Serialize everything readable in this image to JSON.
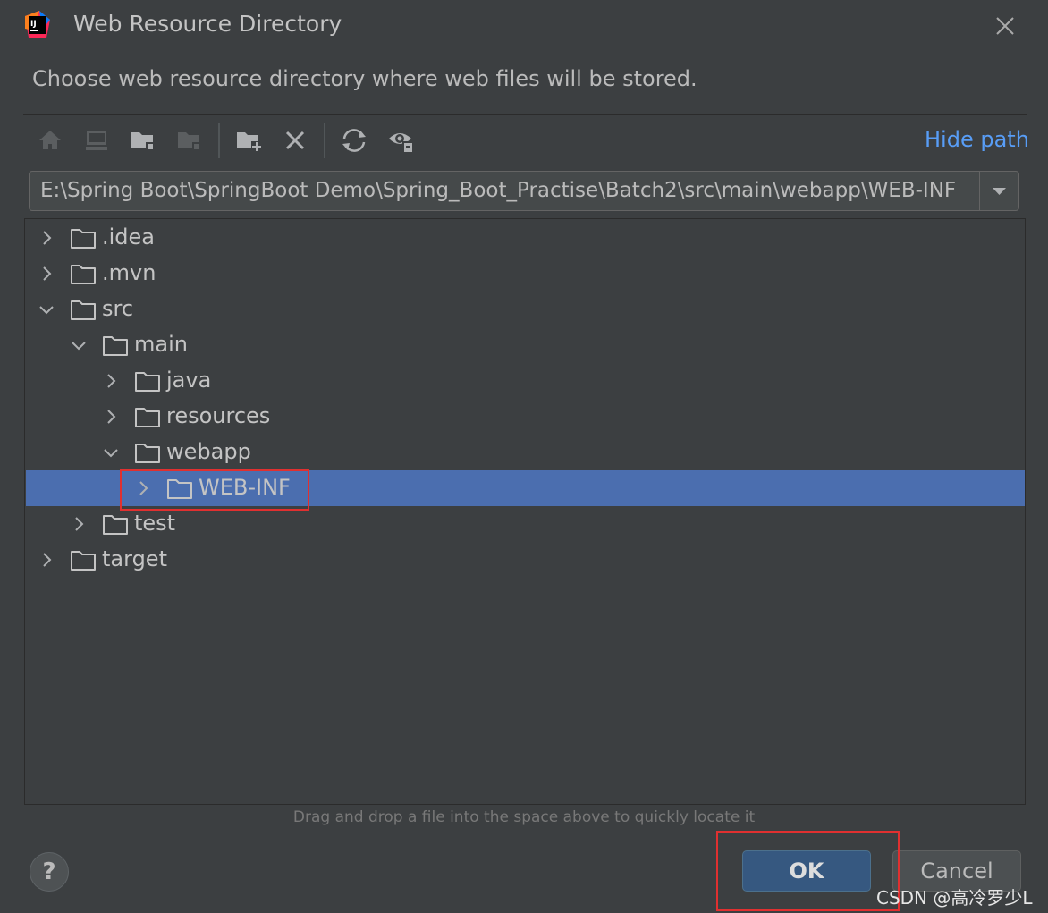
{
  "window": {
    "title": "Web Resource Directory",
    "app_icon": "intellij-idea-icon",
    "close_icon": "close-icon"
  },
  "description": "Choose web resource directory where web files will be stored.",
  "toolbar": {
    "buttons": [
      {
        "name": "home-icon",
        "enabled": false
      },
      {
        "name": "desktop-icon",
        "enabled": false
      },
      {
        "name": "project-folder-icon",
        "enabled": true
      },
      {
        "name": "module-folder-icon",
        "enabled": false
      },
      {
        "name": "new-folder-icon",
        "enabled": true
      },
      {
        "name": "delete-icon",
        "enabled": true
      },
      {
        "name": "refresh-icon",
        "enabled": true
      },
      {
        "name": "show-hidden-icon",
        "enabled": true
      }
    ],
    "hide_path_label": "Hide path"
  },
  "path": {
    "value": "E:\\Spring Boot\\SpringBoot Demo\\Spring_Boot_Practise\\Batch2\\src\\main\\webapp\\WEB-INF"
  },
  "tree": {
    "rows": [
      {
        "label": ".idea",
        "depth": 0,
        "expanded": false,
        "selected": false
      },
      {
        "label": ".mvn",
        "depth": 0,
        "expanded": false,
        "selected": false
      },
      {
        "label": "src",
        "depth": 0,
        "expanded": true,
        "selected": false
      },
      {
        "label": "main",
        "depth": 1,
        "expanded": true,
        "selected": false
      },
      {
        "label": "java",
        "depth": 2,
        "expanded": false,
        "selected": false
      },
      {
        "label": "resources",
        "depth": 2,
        "expanded": false,
        "selected": false
      },
      {
        "label": "webapp",
        "depth": 2,
        "expanded": true,
        "selected": false
      },
      {
        "label": "WEB-INF",
        "depth": 3,
        "expanded": false,
        "selected": true
      },
      {
        "label": "test",
        "depth": 1,
        "expanded": false,
        "selected": false
      },
      {
        "label": "target",
        "depth": 0,
        "expanded": false,
        "selected": false
      }
    ]
  },
  "hint": "Drag and drop a file into the space above to quickly locate it",
  "footer": {
    "help_label": "?",
    "ok_label": "OK",
    "cancel_label": "Cancel"
  },
  "watermark": "CSDN @高冷罗少L",
  "colors": {
    "background": "#3c3f41",
    "selection": "#4b6eaf",
    "link": "#589df6",
    "ok_button": "#365880",
    "highlight_box": "#e03030"
  }
}
